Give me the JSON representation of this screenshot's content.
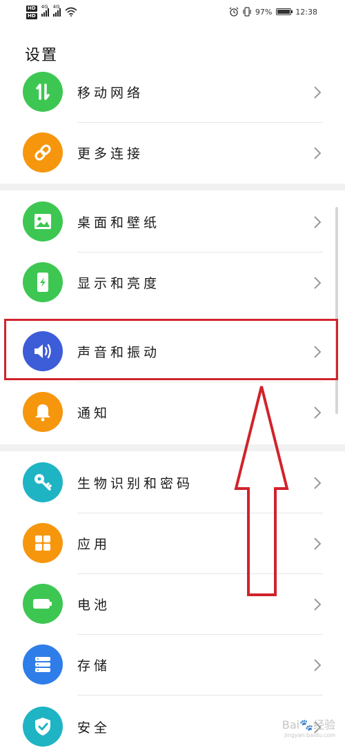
{
  "status_bar": {
    "hd1": "HD",
    "hd2": "HD",
    "net1": "4G",
    "net2": "4G",
    "battery_text": "97%",
    "battery_level": 0.97,
    "time": "12:38"
  },
  "page_title": "设置",
  "items": [
    {
      "label": "移动网络",
      "icon": "data-transfer-icon",
      "color": "#3dc752"
    },
    {
      "label": "更多连接",
      "icon": "link-icon",
      "color": "#f6960d"
    },
    {
      "label": "桌面和壁纸",
      "icon": "image-icon",
      "color": "#3dc752"
    },
    {
      "label": "显示和亮度",
      "icon": "phone-display-icon",
      "color": "#3dc752"
    },
    {
      "label": "声音和振动",
      "icon": "speaker-icon",
      "color": "#3d5cd8"
    },
    {
      "label": "通知",
      "icon": "bell-icon",
      "color": "#f6960d"
    },
    {
      "label": "生物识别和密码",
      "icon": "key-icon",
      "color": "#1fb4c4"
    },
    {
      "label": "应用",
      "icon": "apps-grid-icon",
      "color": "#f6960d"
    },
    {
      "label": "电池",
      "icon": "battery-icon",
      "color": "#3dc752"
    },
    {
      "label": "存储",
      "icon": "storage-icon",
      "color": "#2f7de8"
    },
    {
      "label": "安全",
      "icon": "shield-icon",
      "color": "#1fb4c4"
    }
  ],
  "annotation": {
    "box_color": "#d0232b",
    "arrow_color": "#d0232b"
  },
  "watermark": {
    "text": "Bai🐾经验",
    "sub": "jingyan.baidu.com"
  }
}
